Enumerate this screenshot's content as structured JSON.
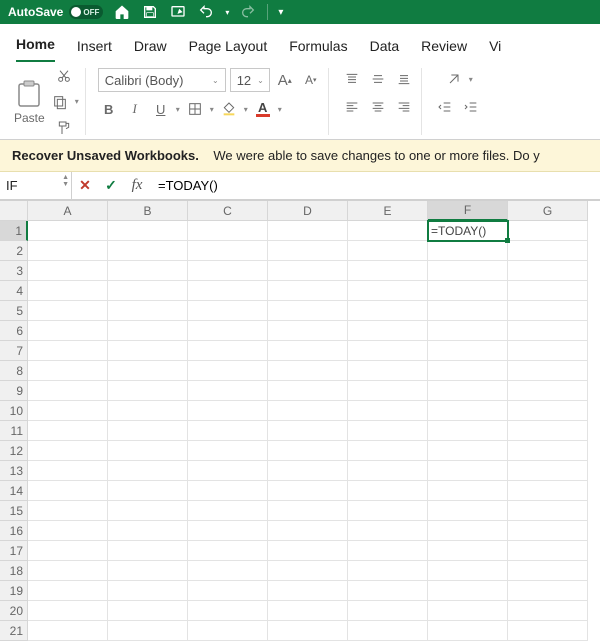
{
  "titlebar": {
    "autosave_label": "AutoSave",
    "autosave_state": "OFF"
  },
  "tabs": [
    "Home",
    "Insert",
    "Draw",
    "Page Layout",
    "Formulas",
    "Data",
    "Review",
    "Vi"
  ],
  "active_tab": "Home",
  "ribbon": {
    "paste_label": "Paste",
    "font_name": "Calibri (Body)",
    "font_size": "12",
    "bold": "B",
    "italic": "I",
    "underline": "U",
    "increase_font": "A",
    "decrease_font": "A"
  },
  "msgbar": {
    "title": "Recover Unsaved Workbooks.",
    "body": "We were able to save changes to one or more files. Do y"
  },
  "formula": {
    "namebox": "IF",
    "value": "=TODAY()"
  },
  "grid": {
    "columns": [
      "A",
      "B",
      "C",
      "D",
      "E",
      "F",
      "G"
    ],
    "active_col": "F",
    "active_row": 1,
    "rows": 21,
    "active_cell_value": "=TODAY()"
  }
}
